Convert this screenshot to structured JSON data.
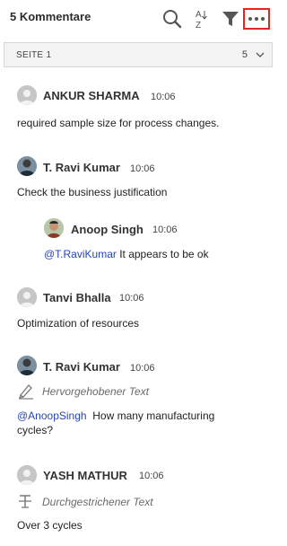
{
  "header": {
    "title": "5 Kommentare",
    "sort_letters": {
      "top": "A",
      "bottom": "Z"
    }
  },
  "page_filter": {
    "label": "SEITE 1",
    "count": "5"
  },
  "colors": {
    "mention": "#2645b8",
    "highlight_border": "#e8231f"
  },
  "comments": [
    {
      "author": "ANKUR SHARMA",
      "time": "10:06",
      "avatar": "placeholder-avatar",
      "text": "required sample size for process changes."
    },
    {
      "author": "T. Ravi Kumar",
      "time": "10:06",
      "avatar": "photo-avatar",
      "text": "Check the business justification",
      "reply": {
        "author": "Anoop Singh",
        "time": "10:06",
        "avatar": "photo-avatar",
        "mention": "@T.RaviKumar",
        "text": " It appears to be ok"
      }
    },
    {
      "author": "Tanvi Bhalla",
      "time": "10:06",
      "avatar": "placeholder-avatar",
      "text": "Optimization of resources"
    },
    {
      "author": "T. Ravi Kumar",
      "time": "10:06",
      "avatar": "photo-avatar",
      "annotation_icon": "highlighter-icon",
      "annotation_type": "Hervorgehobener Text",
      "mention": "@AnoopSingh",
      "text_line1": "  How many manufacturing",
      "text_line2": "cycles?"
    },
    {
      "author": "YASH MATHUR",
      "time": "10:06",
      "avatar": "placeholder-avatar",
      "annotation_icon": "strikethrough-icon",
      "annotation_type": "Durchgestrichener Text",
      "text": "Over 3 cycles"
    }
  ]
}
